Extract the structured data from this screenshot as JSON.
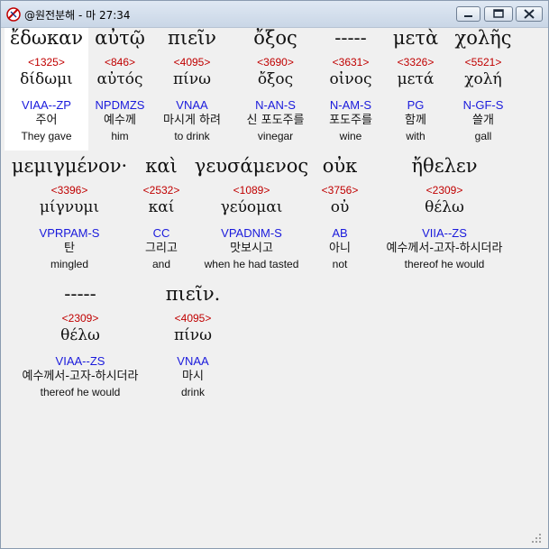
{
  "window": {
    "title": "@원전분해 - 마 27:34",
    "controls": {
      "minimize_icon": "minimize-icon",
      "maximize_icon": "maximize-icon",
      "close_icon": "close-icon"
    }
  },
  "rows": [
    {
      "words": [
        {
          "greek": "ἔδωκαν",
          "strong": "<1325>",
          "lemma": "δίδωμι",
          "parse": "VIAA--ZP",
          "korean": "주어",
          "english": "They gave",
          "highlight": true
        },
        {
          "greek": "αὐτῷ",
          "strong": "<846>",
          "lemma": "αὐτός",
          "parse": "NPDMZS",
          "korean": "예수께",
          "english": "him"
        },
        {
          "greek": "πιεῖν",
          "strong": "<4095>",
          "lemma": "πίνω",
          "parse": "VNAA",
          "korean": "마시게 하려",
          "english": "to drink"
        },
        {
          "greek": "ὄξος",
          "strong": "<3690>",
          "lemma": "ὄξος",
          "parse": "N-AN-S",
          "korean": "신 포도주를",
          "english": "vinegar"
        },
        {
          "greek": "-----",
          "strong": "<3631>",
          "lemma": "οἰνος",
          "parse": "N-AM-S",
          "korean": "포도주를",
          "english": "wine"
        },
        {
          "greek": "μετὰ",
          "strong": "<3326>",
          "lemma": "μετά",
          "parse": "PG",
          "korean": "함께",
          "english": "with"
        },
        {
          "greek": "χολῆς",
          "strong": "<5521>",
          "lemma": "χολή",
          "parse": "N-GF-S",
          "korean": "쓸개",
          "english": "gall"
        }
      ]
    },
    {
      "words": [
        {
          "greek": "μεμιγμένον·",
          "strong": "<3396>",
          "lemma": "μίγνυμι",
          "parse": "VPRPAM-S",
          "korean": "탄",
          "english": "mingled"
        },
        {
          "greek": "καὶ",
          "strong": "<2532>",
          "lemma": "καί",
          "parse": "CC",
          "korean": "그리고",
          "english": "and"
        },
        {
          "greek": "γευσάμενος",
          "strong": "<1089>",
          "lemma": "γεύομαι",
          "parse": "VPADNM-S",
          "korean": "맛보시고",
          "english": "when he had tasted"
        },
        {
          "greek": "οὐκ",
          "strong": "<3756>",
          "lemma": "οὐ",
          "parse": "AB",
          "korean": "아니",
          "english": "not"
        },
        {
          "greek": "ἤθελεν",
          "strong": "<2309>",
          "lemma": "θέλω",
          "parse": "VIIA--ZS",
          "korean": "예수께서-고자-하시더라",
          "english": "thereof he would"
        }
      ]
    },
    {
      "words": [
        {
          "greek": "-----",
          "strong": "<2309>",
          "lemma": "θέλω",
          "parse": "VIAA--ZS",
          "korean": "예수께서-고자-하시더라",
          "english": "thereof he would"
        },
        {
          "greek": "πιεῖν.",
          "strong": "<4095>",
          "lemma": "πίνω",
          "parse": "VNAA",
          "korean": "마시",
          "english": "drink"
        }
      ]
    }
  ]
}
